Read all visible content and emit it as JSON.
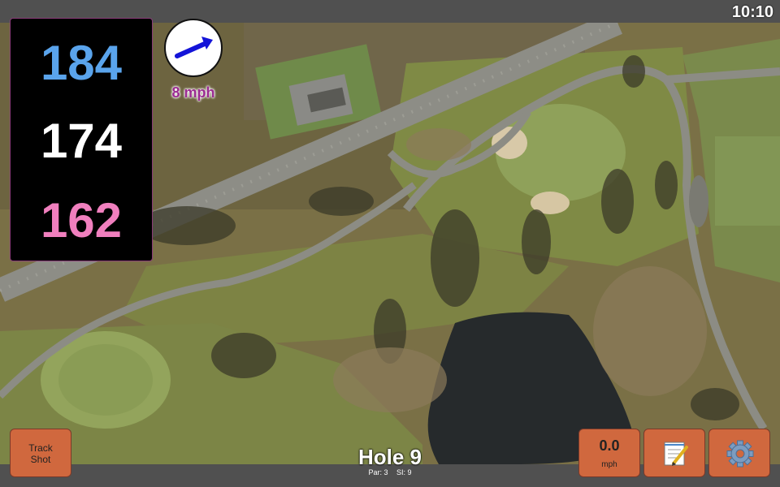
{
  "status": {
    "time": "10:10"
  },
  "distances": {
    "back": "184",
    "middle": "174",
    "front": "162"
  },
  "wind": {
    "speed_label": "8 mph",
    "direction": "east-northeast"
  },
  "hole": {
    "title": "Hole 9",
    "par_label": "Par: 3",
    "si_label": "SI: 9"
  },
  "buttons": {
    "track_shot_line1": "Track",
    "track_shot_line2": "Shot",
    "speed_value": "0.0",
    "speed_unit": "mph",
    "notes_icon": "notepad-icon",
    "settings_icon": "gear-icon"
  },
  "colors": {
    "back_distance": "#5aa4ec",
    "middle_distance": "#ffffff",
    "front_distance": "#f07fbe",
    "wind_text": "#9b2b92",
    "button": "#d0683e"
  }
}
